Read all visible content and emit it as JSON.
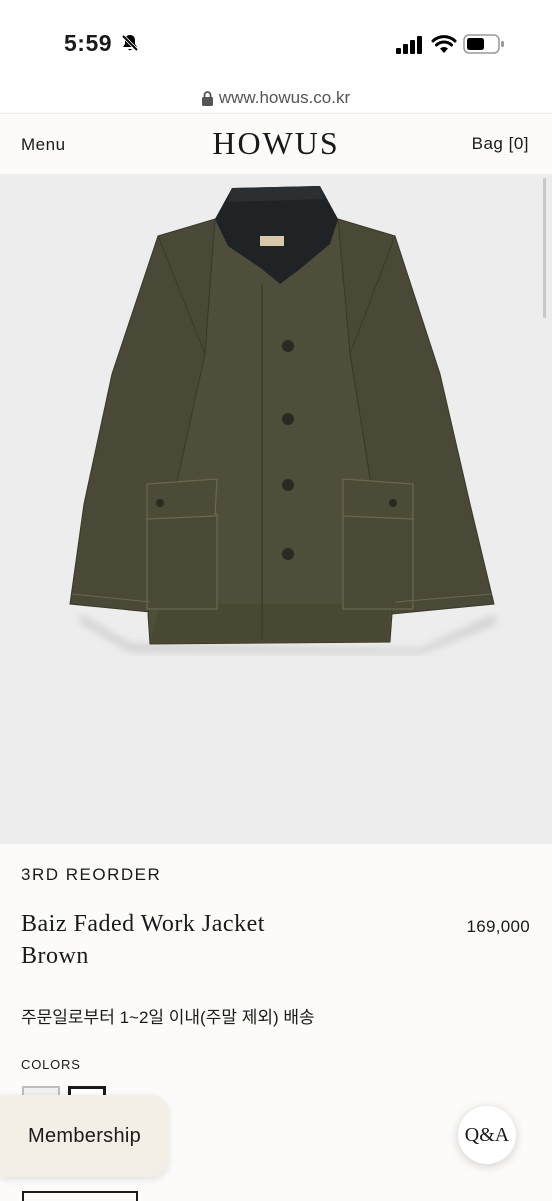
{
  "status_bar": {
    "time": "5:59"
  },
  "browser": {
    "url": "www.howus.co.kr"
  },
  "header": {
    "menu_label": "Menu",
    "logo": "HOWUS",
    "bag_label": "Bag [0]"
  },
  "product": {
    "label": "3RD REORDER",
    "name_line1": "Baiz Faded Work Jacket",
    "name_line2": "Brown",
    "price": "169,000",
    "delivery": "주문일로부터 1~2일 이내(주말 제외) 배송",
    "colors_label": "COLORS",
    "image_icon": "jacket-image",
    "colors": {
      "jacket": "#4b4a36",
      "collar": "#1f2326",
      "background": "#ededed"
    }
  },
  "floating": {
    "membership_label": "Membership",
    "qa_label": "Q&A"
  }
}
